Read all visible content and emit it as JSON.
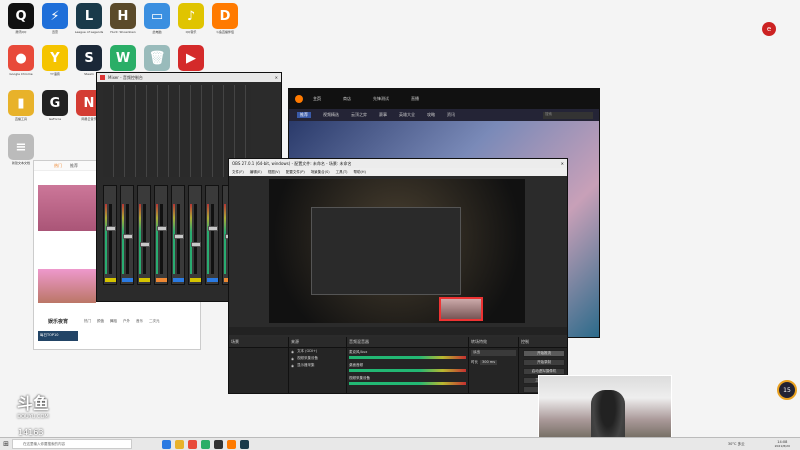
{
  "desktop": {
    "icons": [
      {
        "label": "腾讯QQ",
        "glyph": "Q",
        "color": "#111111"
      },
      {
        "label": "迅雷",
        "glyph": "⚡",
        "color": "#1f6fd9"
      },
      {
        "label": "League of Legends",
        "glyph": "L",
        "color": "#1a3a4a"
      },
      {
        "label": "Hunt: Showdown",
        "glyph": "H",
        "color": "#5b4a2a"
      },
      {
        "label": "此电脑",
        "glyph": "▭",
        "color": "#3b8fe0"
      },
      {
        "label": "QQ音乐",
        "glyph": "♪",
        "color": "#e0c400"
      },
      {
        "label": "斗鱼直播伴侣",
        "glyph": "D",
        "color": "#ff7a00"
      },
      {
        "label": "Google Chrome",
        "glyph": "●",
        "color": "#e84a3a"
      },
      {
        "label": "YY语音",
        "glyph": "Y",
        "color": "#f5c400"
      },
      {
        "label": "Steam",
        "glyph": "S",
        "color": "#1b2838"
      },
      {
        "label": "微信",
        "glyph": "W",
        "color": "#2aae67"
      },
      {
        "label": "回收站",
        "glyph": "🗑",
        "color": "#9bb"
      },
      {
        "label": "斗鱼",
        "glyph": "▶",
        "color": "#d42a2a"
      },
      {
        "label": "直播工具",
        "glyph": "▮",
        "color": "#e8b22a"
      },
      {
        "label": "GeForce",
        "glyph": "G",
        "color": "#222222"
      },
      {
        "label": "网易云音乐",
        "glyph": "N",
        "color": "#d43c33"
      },
      {
        "label": "新建文本文档",
        "glyph": "≡",
        "color": "#bbbbbb"
      }
    ]
  },
  "mixer_window": {
    "title": "Mixer - 音频控制台"
  },
  "client_window": {
    "nav": [
      "主页",
      "商店",
      "先锋测试",
      "直播"
    ],
    "tabs": [
      "推荐",
      "视频精选",
      "云顶之弈",
      "赛事",
      "英雄大全",
      "攻略",
      "资讯"
    ],
    "search_placeholder": "搜索"
  },
  "obs": {
    "title": "OBS 27.0.1 (64-bit, windows) - 配置文件: 未命名 - 场景: 未命名",
    "menu": [
      "文件(F)",
      "编辑(E)",
      "视图(V)",
      "配置文件(P)",
      "场景集合(S)",
      "工具(T)",
      "帮助(H)"
    ],
    "scenes_header": "场景",
    "sources_header": "来源",
    "sources": [
      "文本 (GDI+)",
      "视频采集设备",
      "显示器采集"
    ],
    "mixer_header": "音频混音器",
    "mixer_channels": [
      "麦克风/Aux",
      "桌面音频",
      "视频采集设备"
    ],
    "transition_header": "转场特效",
    "transition_value": "淡出",
    "duration_label": "时长",
    "duration_value": "300 ms",
    "controls_header": "控制",
    "controls": [
      "开始推流",
      "开始录制",
      "启动虚拟摄像机",
      "工作室模式",
      "设置",
      "退出"
    ],
    "status": "LIVE: 00:00:00  REC: 00:00:00  CPU: 2.1%, 30.00 fps"
  },
  "left_panel": {
    "tabs": [
      "热门",
      "推荐"
    ],
    "streamer": "主播",
    "section_title": "娱乐夜宵",
    "sub_tabs": [
      "热门",
      "颜值",
      "舞蹈",
      "户外",
      "音乐",
      "二次元"
    ],
    "banner": "每日TOP10"
  },
  "branding": {
    "logo": "斗鱼",
    "sub": "DOUYU.COM",
    "room_id": "14163"
  },
  "overlay": {
    "circle_value": "15"
  },
  "taskbar": {
    "search_placeholder": "在这里输入你要搜索的内容",
    "weather": "30°C 多云",
    "time": "14:08",
    "date": "2021/8/20"
  },
  "colors": {
    "accent": "#e03a3a",
    "obs_bg": "#2b2b2b",
    "douyu_orange": "#ff7a00"
  }
}
